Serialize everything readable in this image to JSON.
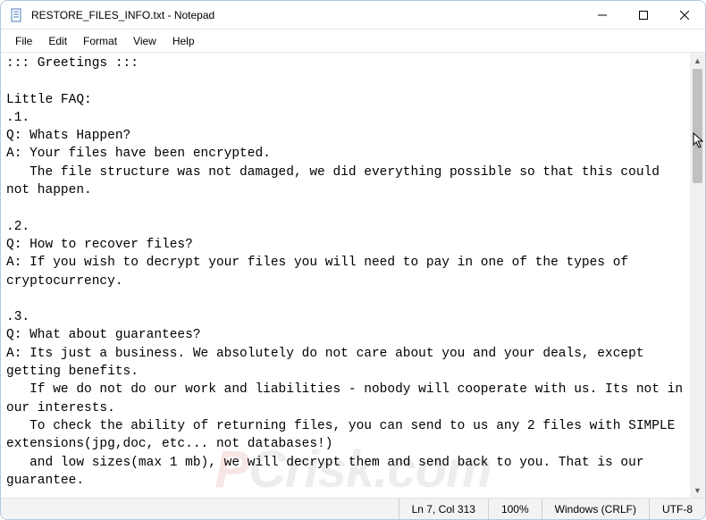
{
  "titlebar": {
    "title": "RESTORE_FILES_INFO.txt - Notepad"
  },
  "menu": {
    "file": "File",
    "edit": "Edit",
    "format": "Format",
    "view": "View",
    "help": "Help"
  },
  "document": {
    "text": "::: Greetings :::\n\nLittle FAQ:\n.1.\nQ: Whats Happen?\nA: Your files have been encrypted.\n   The file structure was not damaged, we did everything possible so that this could not happen.\n\n.2.\nQ: How to recover files?\nA: If you wish to decrypt your files you will need to pay in one of the types of cryptocurrency.\n\n.3.\nQ: What about guarantees?\nA: Its just a business. We absolutely do not care about you and your deals, except getting benefits.\n   If we do not do our work and liabilities - nobody will cooperate with us. Its not in our interests.\n   To check the ability of returning files, you can send to us any 2 files with SIMPLE extensions(jpg,doc, etc... not databases!)\n   and low sizes(max 1 mb), we will decrypt them and send back to you. That is our guarantee."
  },
  "statusbar": {
    "position": "Ln 7, Col 313",
    "zoom": "100%",
    "line_ending": "Windows (CRLF)",
    "encoding": "UTF-8"
  },
  "watermark": {
    "prefix": "P",
    "suffix": "Crisk.com"
  }
}
